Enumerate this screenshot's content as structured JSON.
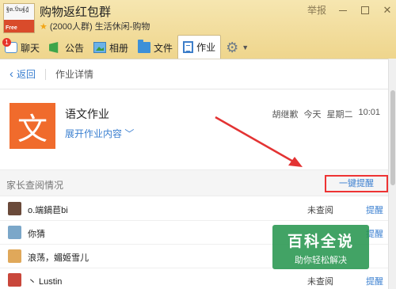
{
  "header": {
    "group_name": "购物返红包群",
    "member_count": "(2000人群)",
    "category": "生活休闲-购物",
    "report_label": "举报",
    "avatar_label": "ฐิต.ปิ่นฐ์ฎั",
    "avatar_badge": "Free"
  },
  "tabs": [
    {
      "label": "聊天",
      "icon": "chat-icon",
      "badge": "1"
    },
    {
      "label": "公告",
      "icon": "notice-flag-icon"
    },
    {
      "label": "相册",
      "icon": "album-icon"
    },
    {
      "label": "文件",
      "icon": "folder-icon"
    },
    {
      "label": "作业",
      "icon": "homework-icon",
      "active": true
    }
  ],
  "nav": {
    "back_label": "返回",
    "title": "作业详情"
  },
  "homework": {
    "icon_char": "文",
    "title": "语文作业",
    "expand_label": "展开作业内容",
    "author": "胡继歉",
    "date": "今天",
    "weekday": "星期二",
    "time": "10:01"
  },
  "section": {
    "title": "家长查阅情况",
    "remind_all": "一键提醒"
  },
  "parents": [
    {
      "name": "o.端鍋苣bi",
      "status": "未查阅",
      "action": "提醒",
      "avatar_color": "#6a4a3a"
    },
    {
      "name": "你猜",
      "status": "",
      "action": "提醒",
      "avatar_color": "#7ba7c9"
    },
    {
      "name": "浪荡，媚姬雪儿",
      "status": "",
      "action": "",
      "avatar_color": "#e0a85a"
    },
    {
      "name": "丶 Lustin",
      "status": "未查阅",
      "action": "提醒",
      "avatar_color": "#c9473b"
    }
  ],
  "watermark": {
    "line1": "百科全说",
    "line2": "助你轻松解决"
  },
  "colors": {
    "accent": "#3a7fd0",
    "homework_icon_bg": "#f06b2c",
    "highlight_border": "#e33333",
    "header_bg": "#f1da93"
  }
}
